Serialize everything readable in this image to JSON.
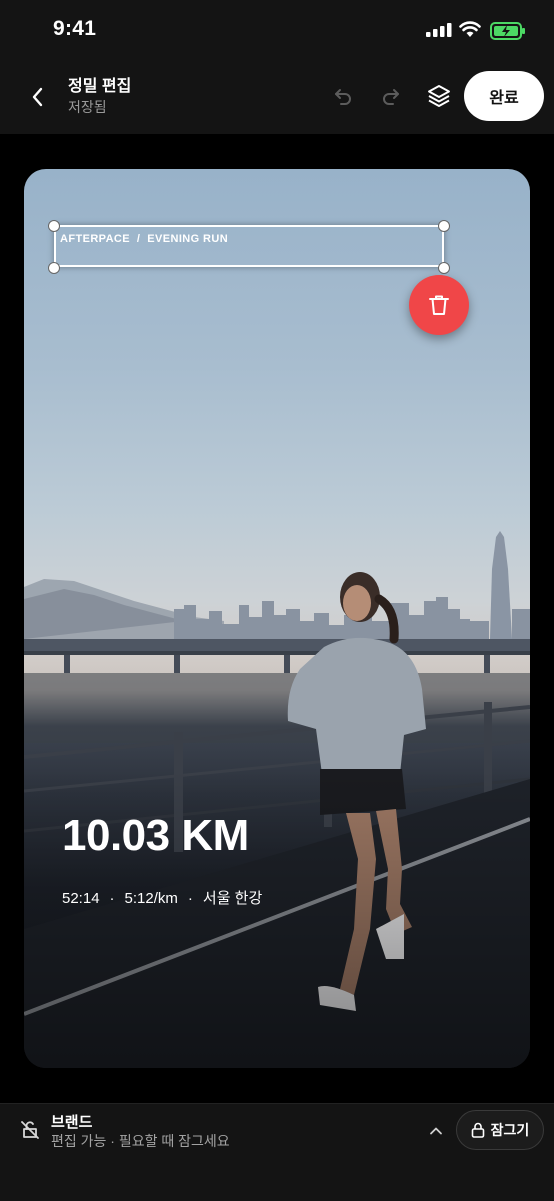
{
  "status_bar": {
    "time": "9:41"
  },
  "header": {
    "title": "정밀 편집",
    "subtitle": "저장됨",
    "done_label": "완료"
  },
  "canvas": {
    "brand_text": "AFTERPACE  /  EVENING RUN",
    "distance": "10.03 KM",
    "stats": {
      "duration": "52:14",
      "pace": "5:12/km",
      "location": "서울 한강"
    },
    "colors": {
      "delete": "#f04648",
      "selection": "#ffffff"
    }
  },
  "layer_panel": {
    "name": "브랜드",
    "hint": "편집 가능 · 필요할 때 잠그세요",
    "lock_label": "잠그기"
  },
  "icons": [
    "back-arrow-icon",
    "undo-icon",
    "redo-icon",
    "layers-icon",
    "trash-icon",
    "unlocked-icon",
    "chevron-up-icon",
    "lock-icon"
  ]
}
